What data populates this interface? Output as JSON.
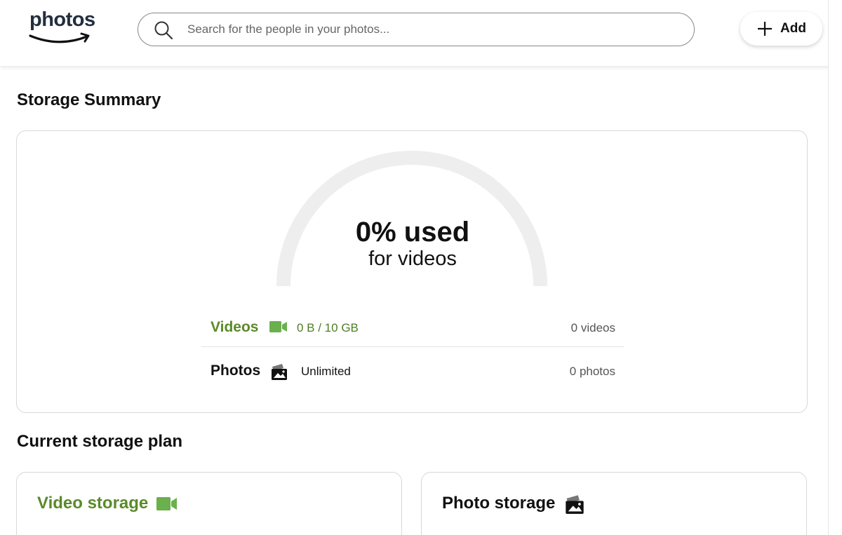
{
  "header": {
    "logo_text": "photos",
    "search": {
      "placeholder": "Search for the people in your photos..."
    },
    "add_label": "Add"
  },
  "storage_summary": {
    "title": "Storage Summary",
    "gauge": {
      "used_percent": 0,
      "headline": "0% used",
      "subtitle": "for videos"
    },
    "rows": [
      {
        "label": "Videos",
        "icon": "video-camera-icon",
        "usage": "0 B / 10 GB",
        "count": "0 videos"
      },
      {
        "label": "Photos",
        "icon": "photo-icon",
        "usage": "Unlimited",
        "count": "0 photos"
      }
    ]
  },
  "current_plan": {
    "title": "Current storage plan",
    "cards": [
      {
        "title": "Video storage",
        "icon": "video-camera-icon"
      },
      {
        "title": "Photo storage",
        "icon": "photo-icon"
      }
    ]
  },
  "colors": {
    "video_green": "#5a8a2a",
    "video_icon_green": "#6ab04c",
    "gauge_track": "#eeeeee",
    "logo_dark": "#232f3e"
  }
}
